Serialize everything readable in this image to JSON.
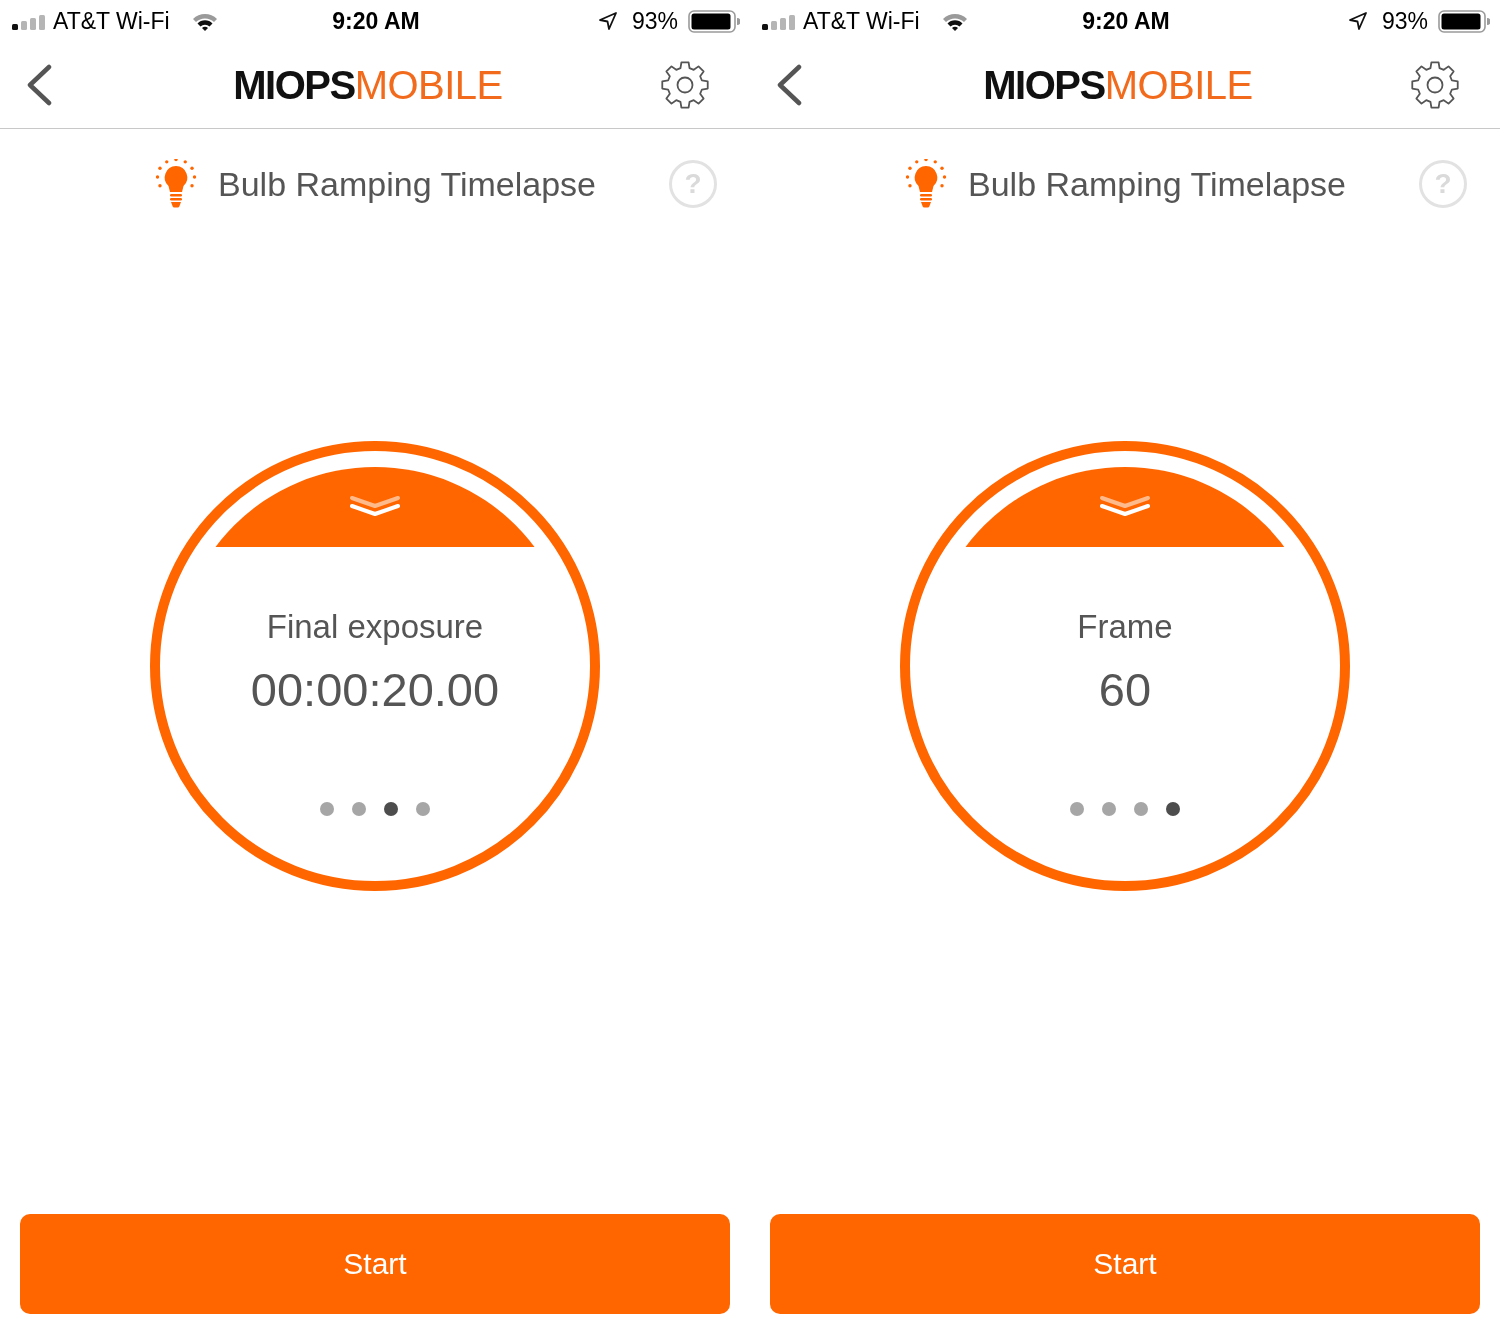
{
  "screens": [
    {
      "status_bar": {
        "carrier": "AT&T Wi-Fi",
        "time": "9:20 AM",
        "battery": "93%"
      },
      "nav_bar": {
        "logo_main": "MIOPS",
        "logo_accent": "MOBILE"
      },
      "mode": {
        "title": "Bulb Ramping Timelapse",
        "help": "?"
      },
      "dial": {
        "label": "Final exposure",
        "value": "00:00:20.00",
        "page_dots": [
          {
            "selected": false
          },
          {
            "selected": false
          },
          {
            "selected": true
          },
          {
            "selected": false
          }
        ]
      },
      "start_button": "Start"
    },
    {
      "status_bar": {
        "carrier": "AT&T Wi-Fi",
        "time": "9:20 AM",
        "battery": "93%"
      },
      "nav_bar": {
        "logo_main": "MIOPS",
        "logo_accent": "MOBILE"
      },
      "mode": {
        "title": "Bulb Ramping Timelapse",
        "help": "?"
      },
      "dial": {
        "label": "Frame",
        "value": "60",
        "page_dots": [
          {
            "selected": false
          },
          {
            "selected": false
          },
          {
            "selected": false
          },
          {
            "selected": true
          }
        ]
      },
      "start_button": "Start"
    }
  ]
}
